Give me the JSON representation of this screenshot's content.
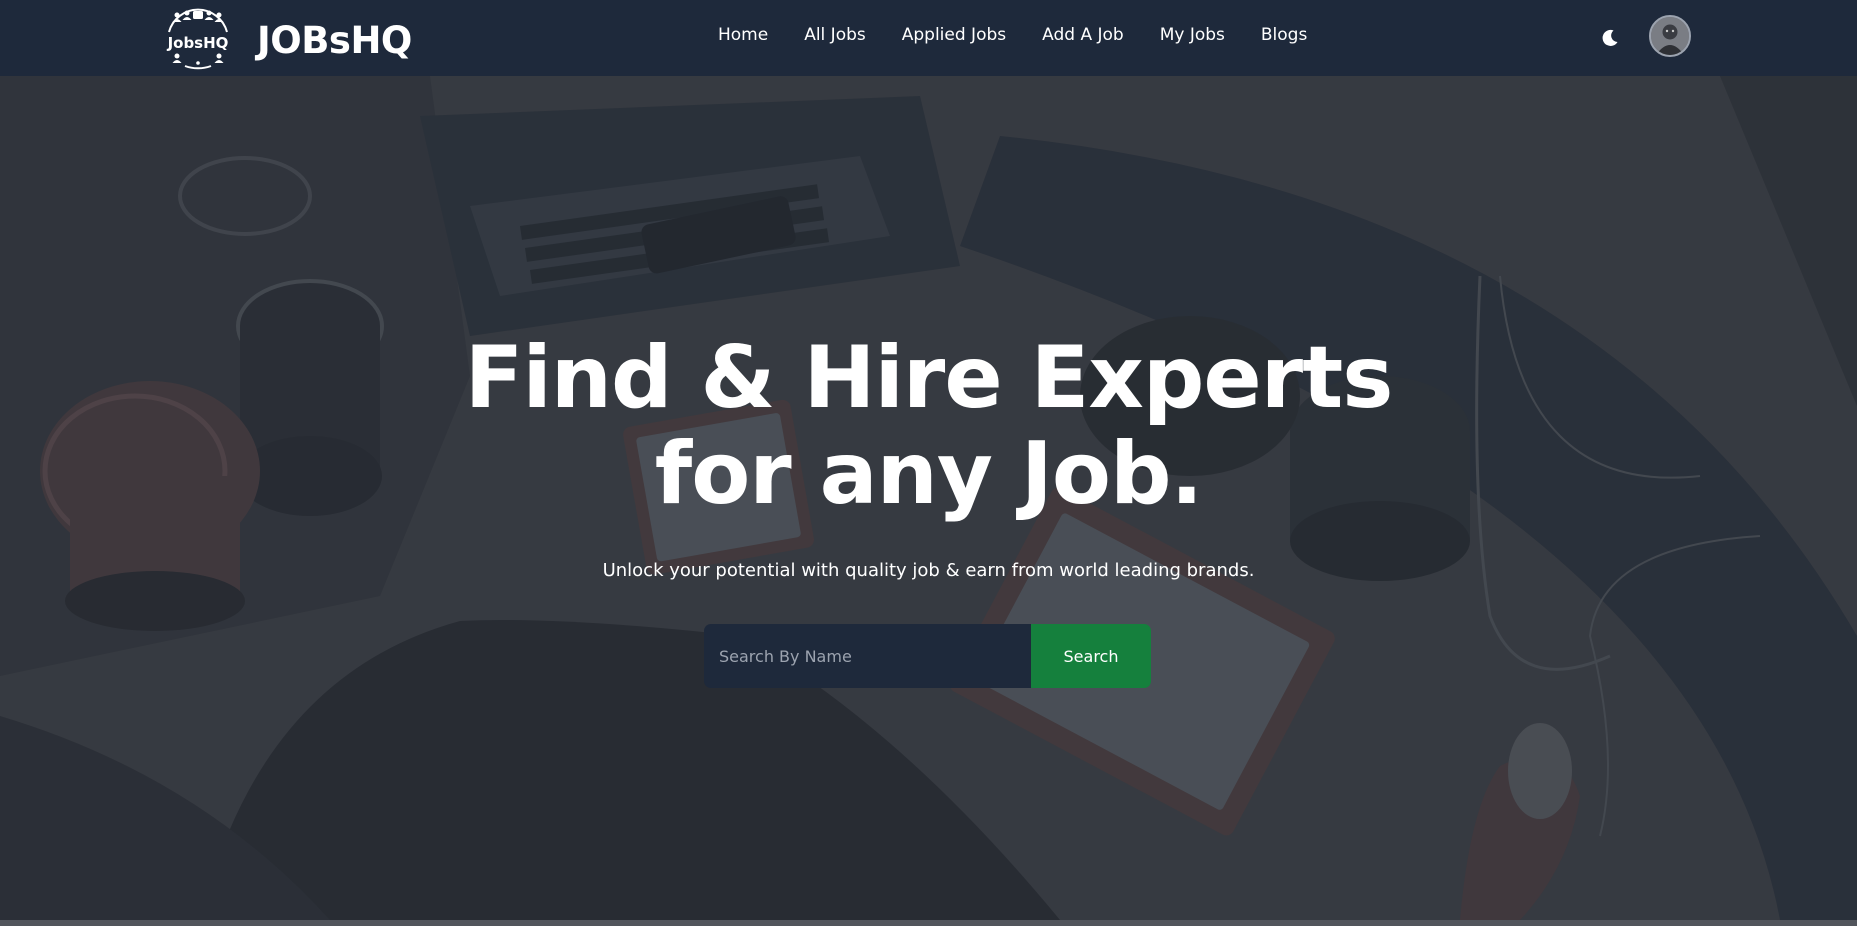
{
  "navbar": {
    "logo_text": "JobsHQ",
    "brand_name": "JOBsHQ",
    "links": [
      {
        "label": "Home"
      },
      {
        "label": "All Jobs"
      },
      {
        "label": "Applied Jobs"
      },
      {
        "label": "Add A Job"
      },
      {
        "label": "My Jobs"
      },
      {
        "label": "Blogs"
      }
    ],
    "theme_icon": "moon-icon",
    "avatar_icon": "user-avatar"
  },
  "hero": {
    "title_line1": "Find & Hire Experts",
    "title_line2": "for any Job.",
    "subtitle": "Unlock your potential with quality job & earn from world leading brands.",
    "search": {
      "placeholder": "Search By Name",
      "value": "",
      "button_label": "Search"
    }
  },
  "colors": {
    "navbar_bg": "#1e293b",
    "search_button": "#15803d",
    "input_bg": "#1e293b",
    "text": "#ffffff"
  }
}
